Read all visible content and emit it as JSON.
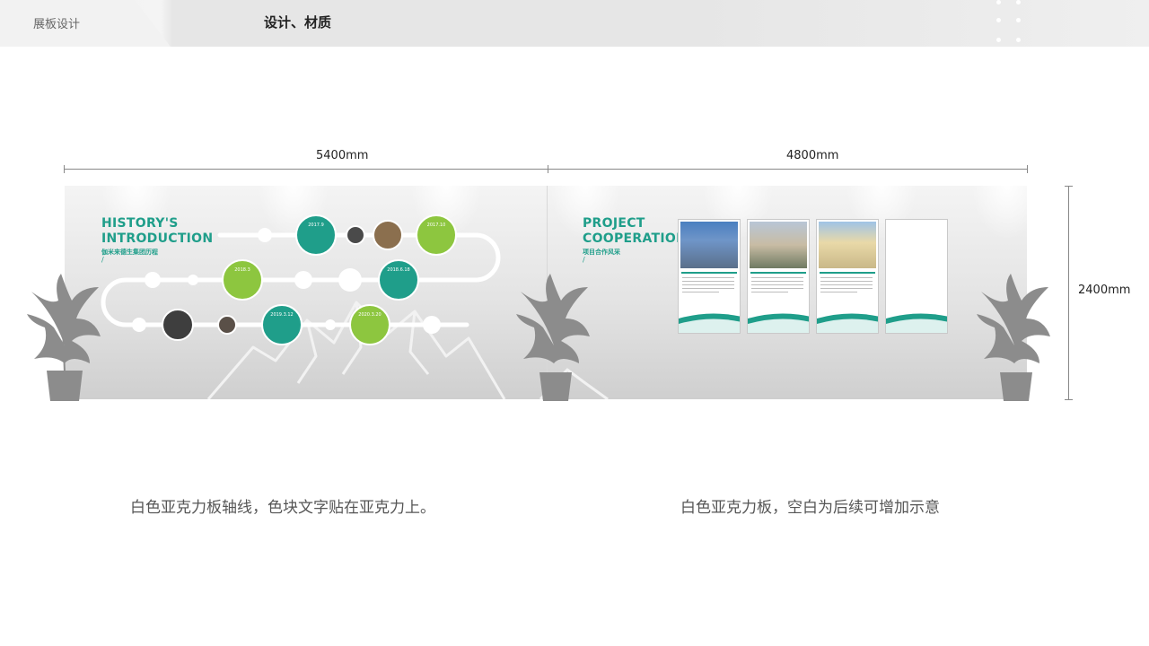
{
  "header": {
    "section_label": "展板设计",
    "title": "设计、材质"
  },
  "dimensions": {
    "left_width": "5400mm",
    "right_width": "4800mm",
    "height": "2400mm"
  },
  "left_board": {
    "title_line1": "HISTORY'S",
    "title_line2": "INTRODUCTION",
    "subtitle": "伽米来德生集团历程",
    "slash": "/",
    "milestones": [
      "2017.9",
      "2017.10",
      "2018.3",
      "2018.6.18",
      "2019.3.12",
      "2020.3.20"
    ]
  },
  "right_board": {
    "title_line1": "PROJECT",
    "title_line2": "COOPERATION",
    "subtitle": "项目合作风采",
    "slash": "/"
  },
  "captions": {
    "left": "白色亚克力板轴线，色块文字贴在亚克力上。",
    "right": "白色亚克力板，空白为后续可增加示意"
  },
  "colors": {
    "teal": "#1f9e8a",
    "green": "#8dc63f",
    "plant_gray": "#8c8c8c"
  }
}
